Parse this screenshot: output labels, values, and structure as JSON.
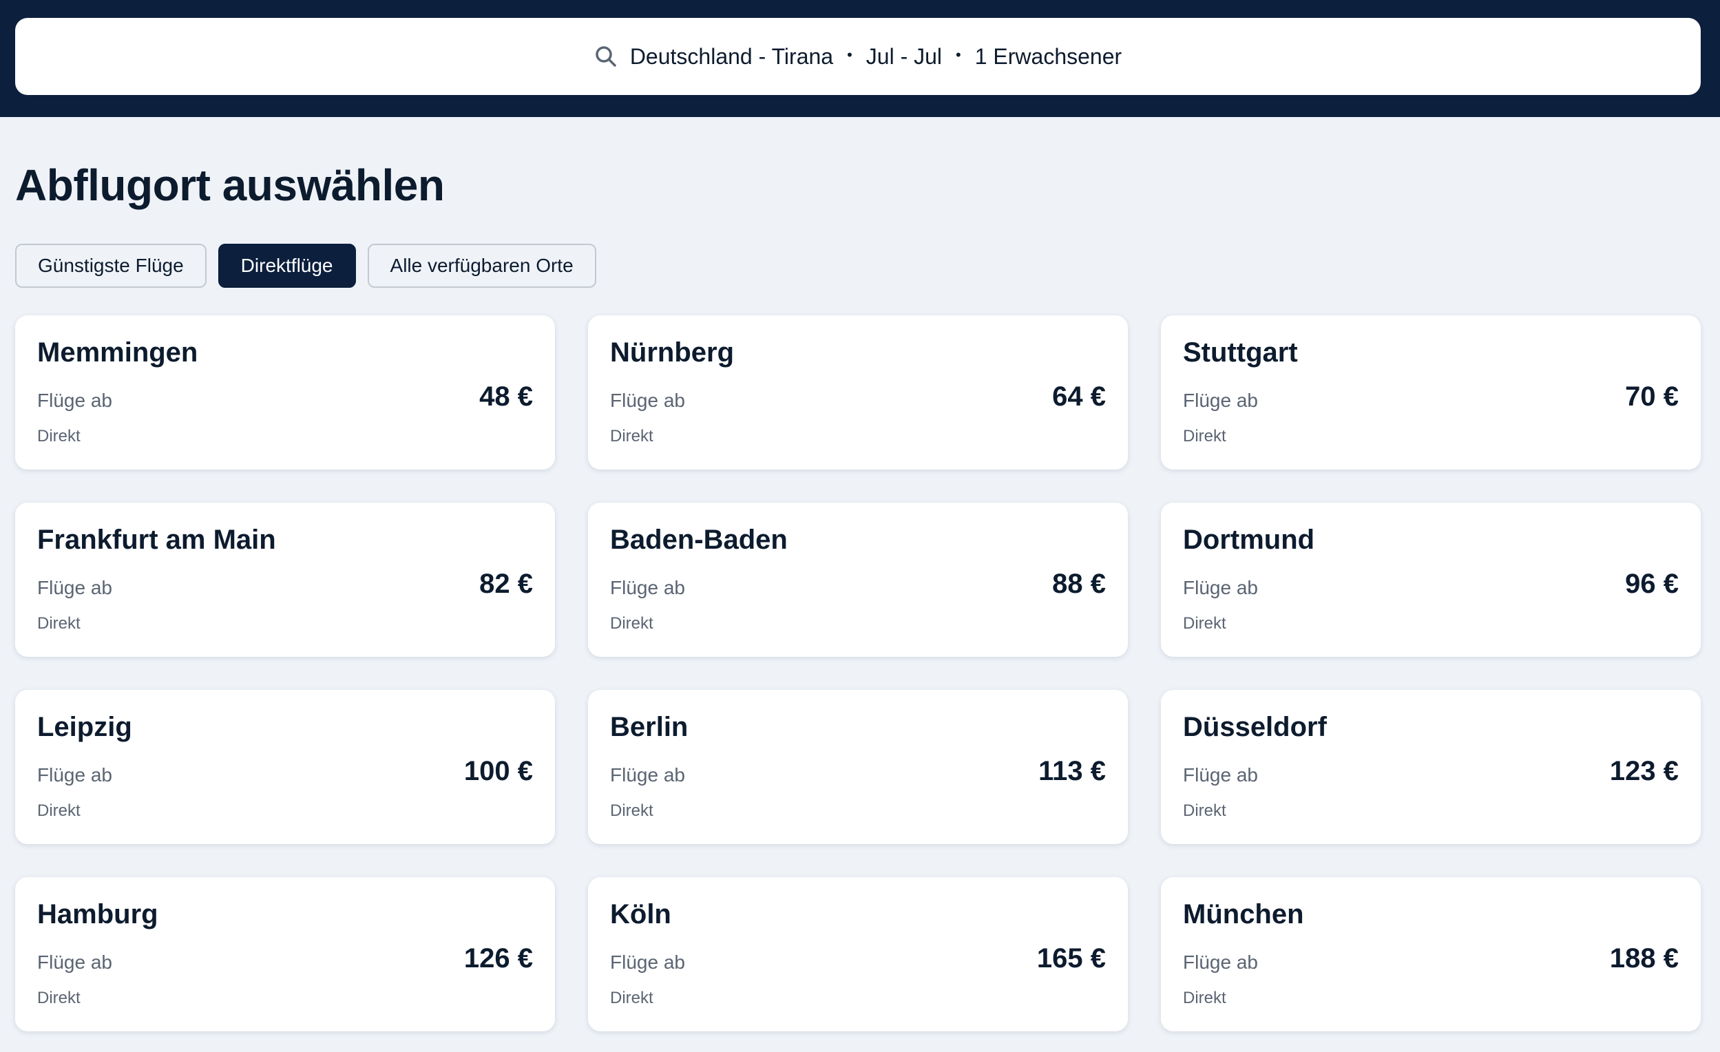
{
  "search": {
    "route": "Deutschland - Tirana",
    "dates": "Jul - Jul",
    "travellers": "1 Erwachsener",
    "separator": "•"
  },
  "page_title": "Abflugort auswählen",
  "filters": [
    {
      "label": "Günstigste Flüge",
      "active": false
    },
    {
      "label": "Direktflüge",
      "active": true
    },
    {
      "label": "Alle verfügbaren Orte",
      "active": false
    }
  ],
  "results": [
    {
      "city": "Memmingen",
      "from_label": "Flüge ab",
      "price": "48 €",
      "stops": "Direkt"
    },
    {
      "city": "Nürnberg",
      "from_label": "Flüge ab",
      "price": "64 €",
      "stops": "Direkt"
    },
    {
      "city": "Stuttgart",
      "from_label": "Flüge ab",
      "price": "70 €",
      "stops": "Direkt"
    },
    {
      "city": "Frankfurt am Main",
      "from_label": "Flüge ab",
      "price": "82 €",
      "stops": "Direkt"
    },
    {
      "city": "Baden-Baden",
      "from_label": "Flüge ab",
      "price": "88 €",
      "stops": "Direkt"
    },
    {
      "city": "Dortmund",
      "from_label": "Flüge ab",
      "price": "96 €",
      "stops": "Direkt"
    },
    {
      "city": "Leipzig",
      "from_label": "Flüge ab",
      "price": "100 €",
      "stops": "Direkt"
    },
    {
      "city": "Berlin",
      "from_label": "Flüge ab",
      "price": "113 €",
      "stops": "Direkt"
    },
    {
      "city": "Düsseldorf",
      "from_label": "Flüge ab",
      "price": "123 €",
      "stops": "Direkt"
    },
    {
      "city": "Hamburg",
      "from_label": "Flüge ab",
      "price": "126 €",
      "stops": "Direkt"
    },
    {
      "city": "Köln",
      "from_label": "Flüge ab",
      "price": "165 €",
      "stops": "Direkt"
    },
    {
      "city": "München",
      "from_label": "Flüge ab",
      "price": "188 €",
      "stops": "Direkt"
    }
  ],
  "colors": {
    "header_bg": "#0c1f3d",
    "page_bg": "#eff3f8",
    "active_chip_bg": "#0c1f3d",
    "text_primary": "#0d1b2e",
    "text_secondary": "#5b6472"
  },
  "icons": {
    "search": "search-icon"
  }
}
